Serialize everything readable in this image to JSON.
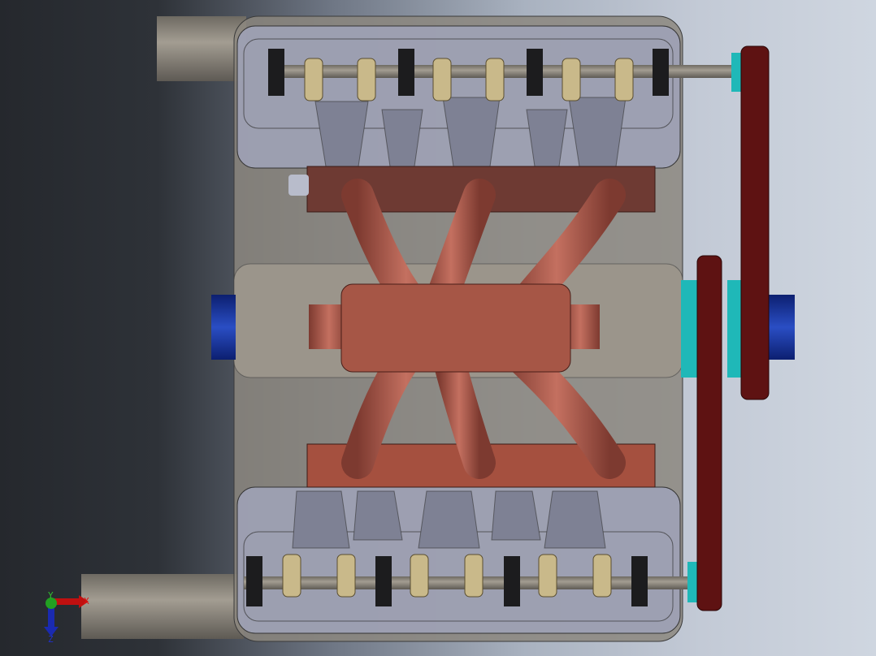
{
  "viewport": {
    "model": "v-engine-assembly",
    "view": "top",
    "colors": {
      "intake": "#a65646",
      "crank_end": "#1a3aa8",
      "pulley_hub": "#1fb8b8",
      "belt": "#5e1212",
      "block": "#8c877f",
      "head": "#9fa2b6"
    }
  },
  "triad": {
    "x_label": "X",
    "y_label": "Y",
    "z_label": "Z"
  }
}
